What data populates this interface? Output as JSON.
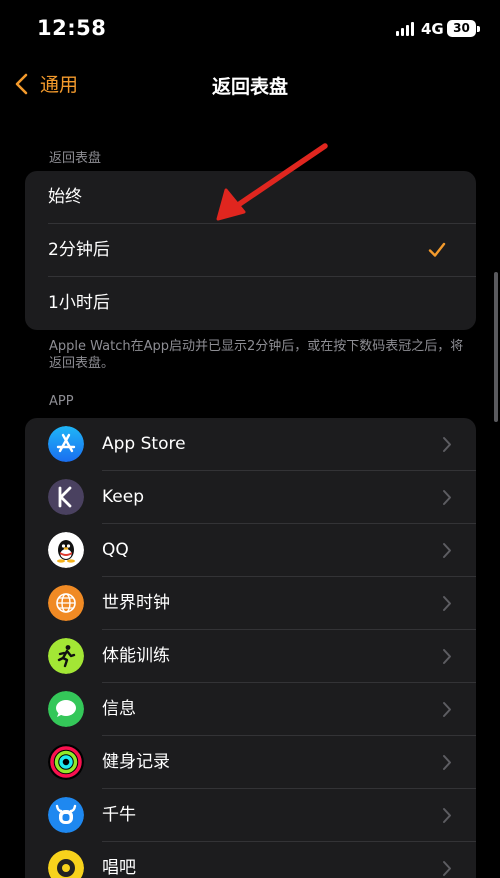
{
  "status": {
    "time": "12:58",
    "network": "4G",
    "battery": "30"
  },
  "nav": {
    "back_label": "通用",
    "title": "返回表盘"
  },
  "return_section": {
    "header": "返回表盘",
    "options": [
      {
        "label": "始终",
        "selected": false
      },
      {
        "label": "2分钟后",
        "selected": true
      },
      {
        "label": "1小时后",
        "selected": false
      }
    ],
    "footer": "Apple Watch在App启动并已显示2分钟后，或在按下数码表冠之后，将返回表盘。"
  },
  "app_section": {
    "header": "APP",
    "apps": [
      {
        "label": "App Store",
        "icon": "app-store-icon"
      },
      {
        "label": "Keep",
        "icon": "keep-icon"
      },
      {
        "label": "QQ",
        "icon": "qq-icon"
      },
      {
        "label": "世界时钟",
        "icon": "world-clock-icon"
      },
      {
        "label": "体能训练",
        "icon": "workout-icon"
      },
      {
        "label": "信息",
        "icon": "messages-icon"
      },
      {
        "label": "健身记录",
        "icon": "activity-icon"
      },
      {
        "label": "千牛",
        "icon": "qianniu-icon"
      },
      {
        "label": "唱吧",
        "icon": "changba-icon"
      }
    ]
  },
  "colors": {
    "accent": "#f39a2c",
    "background": "#000000",
    "cell": "#1c1c1e",
    "secondary_text": "#8d8d93",
    "annotation_arrow": "#e0261f"
  }
}
